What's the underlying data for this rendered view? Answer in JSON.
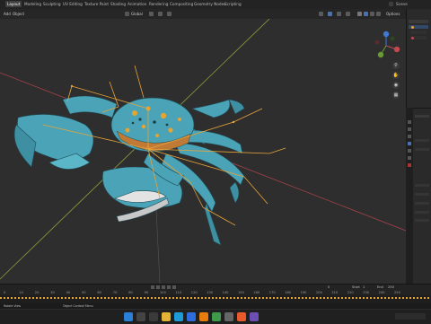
{
  "workspace_tabs": [
    "Layout",
    "Modeling",
    "Sculpting",
    "UV Editing",
    "Texture Paint",
    "Shading",
    "Animation",
    "Rendering",
    "Compositing",
    "Geometry Nodes",
    "Scripting"
  ],
  "scene_label": "Scene",
  "header": {
    "mode_add": "Add",
    "mode_object": "Object",
    "orientation": "Global",
    "options": "Options"
  },
  "timeline": {
    "ticks": [
      "0",
      "10",
      "20",
      "30",
      "40",
      "50",
      "60",
      "70",
      "80",
      "90",
      "100",
      "110",
      "120",
      "130",
      "140",
      "150",
      "160",
      "170",
      "180",
      "190",
      "200",
      "210",
      "220",
      "230",
      "240",
      "250"
    ],
    "current_frame": "0",
    "start_label": "Start",
    "start_value": "1",
    "end_label": "End",
    "end_value": "250"
  },
  "status": {
    "left": "Rotate View",
    "center": "Object Context Menu"
  },
  "colors": {
    "accent": "#4772b3",
    "crab_body": "#4aa3b6",
    "bone": "#e8a33a",
    "viewport_bg": "#2e2e2e",
    "x_axis": "#a8424c",
    "y_axis": "#8ba23c"
  },
  "icons": [
    "windows-start-icon",
    "search-icon",
    "taskview-icon",
    "file-explorer-icon",
    "edge-icon",
    "store-icon",
    "blender-icon",
    "chrome-icon",
    "settings-icon",
    "obs-icon"
  ]
}
